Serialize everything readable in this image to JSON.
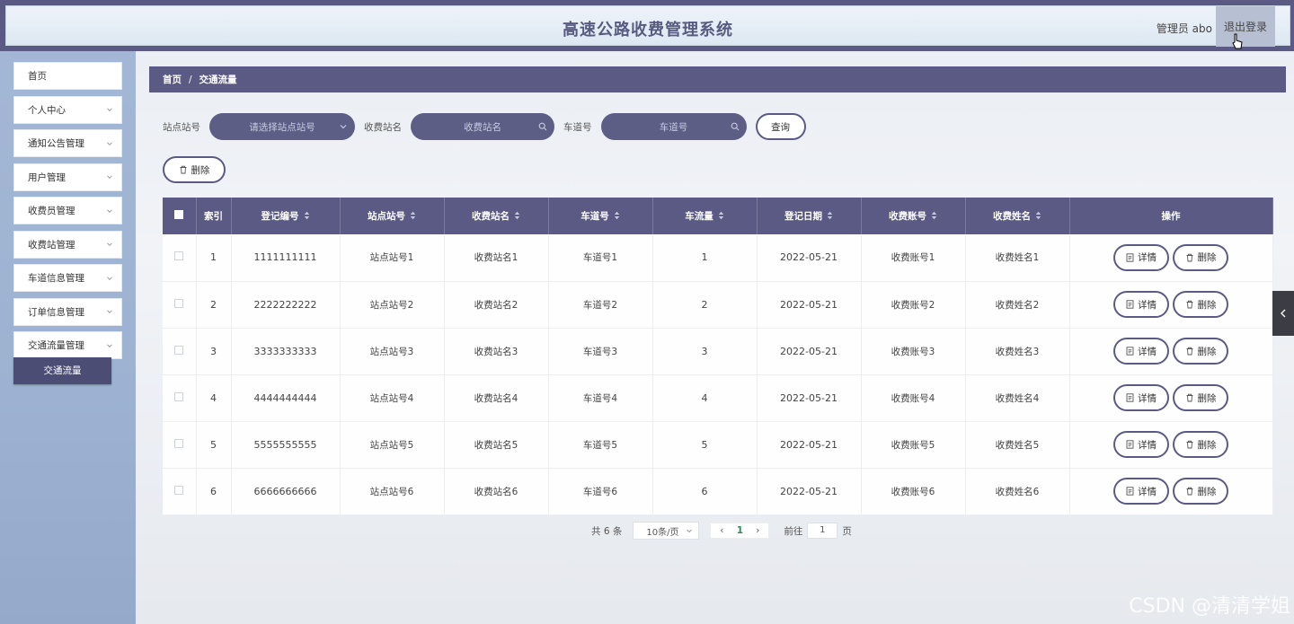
{
  "header": {
    "title": "高速公路收费管理系统",
    "user": "管理员 abo",
    "logout": "退出登录"
  },
  "sidebar": {
    "items": [
      {
        "label": "首页",
        "chevron": false
      },
      {
        "label": "个人中心",
        "chevron": true
      },
      {
        "label": "通知公告管理",
        "chevron": true
      },
      {
        "label": "用户管理",
        "chevron": true
      },
      {
        "label": "收费员管理",
        "chevron": true
      },
      {
        "label": "收费站管理",
        "chevron": true
      },
      {
        "label": "车道信息管理",
        "chevron": true
      },
      {
        "label": "订单信息管理",
        "chevron": true
      },
      {
        "label": "交通流量管理",
        "chevron": true
      }
    ],
    "active_sub": "交通流量"
  },
  "breadcrumb": {
    "home": "首页",
    "sep": "/",
    "current": "交通流量"
  },
  "search": {
    "station_no_label": "站点站号",
    "station_no_placeholder": "请选择站点站号",
    "station_name_label": "收费站名",
    "station_name_placeholder": "收费站名",
    "lane_label": "车道号",
    "lane_placeholder": "车道号",
    "query": "查询"
  },
  "toolbar": {
    "delete": "删除"
  },
  "table": {
    "headers": [
      "索引",
      "登记编号",
      "站点站号",
      "收费站名",
      "车道号",
      "车流量",
      "登记日期",
      "收费账号",
      "收费姓名",
      "操作"
    ],
    "rows": [
      {
        "idx": "1",
        "reg": "1111111111",
        "station": "站点站号1",
        "name": "收费站名1",
        "lane": "车道号1",
        "flow": "1",
        "date": "2022-05-21",
        "account": "收费账号1",
        "person": "收费姓名1"
      },
      {
        "idx": "2",
        "reg": "2222222222",
        "station": "站点站号2",
        "name": "收费站名2",
        "lane": "车道号2",
        "flow": "2",
        "date": "2022-05-21",
        "account": "收费账号2",
        "person": "收费姓名2"
      },
      {
        "idx": "3",
        "reg": "3333333333",
        "station": "站点站号3",
        "name": "收费站名3",
        "lane": "车道号3",
        "flow": "3",
        "date": "2022-05-21",
        "account": "收费账号3",
        "person": "收费姓名3"
      },
      {
        "idx": "4",
        "reg": "4444444444",
        "station": "站点站号4",
        "name": "收费站名4",
        "lane": "车道号4",
        "flow": "4",
        "date": "2022-05-21",
        "account": "收费账号4",
        "person": "收费姓名4"
      },
      {
        "idx": "5",
        "reg": "5555555555",
        "station": "站点站号5",
        "name": "收费站名5",
        "lane": "车道号5",
        "flow": "5",
        "date": "2022-05-21",
        "account": "收费账号5",
        "person": "收费姓名5"
      },
      {
        "idx": "6",
        "reg": "6666666666",
        "station": "站点站号6",
        "name": "收费站名6",
        "lane": "车道号6",
        "flow": "6",
        "date": "2022-05-21",
        "account": "收费账号6",
        "person": "收费姓名6"
      }
    ],
    "detail_label": "详情",
    "delete_label": "删除"
  },
  "pagination": {
    "total": "共 6 条",
    "page_size": "10条/页",
    "current_page": "1",
    "goto_label": "前往",
    "goto_value": "1",
    "page_suffix": "页"
  },
  "watermark": "CSDN @清清学姐",
  "colors": {
    "primary": "#5a5a84",
    "sidebar": "#a3b6d6",
    "active": "#4c4d74"
  }
}
